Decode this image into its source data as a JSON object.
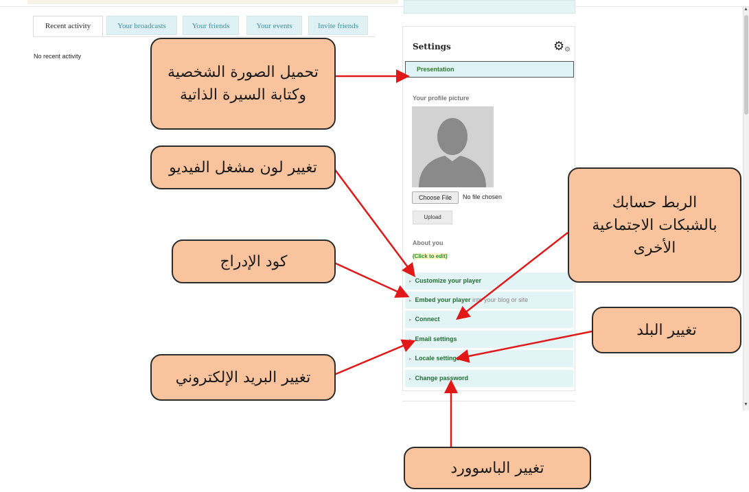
{
  "tabs": [
    "Recent activity",
    "Your broadcasts",
    "Your friends",
    "Your events",
    "Invite friends"
  ],
  "activity": {
    "empty_text": "No recent activity"
  },
  "settings": {
    "title": "Settings",
    "presentation": "Presentation",
    "profile_picture_label": "Your profile picture",
    "choose_file": "Choose File",
    "no_file": "No file chosen",
    "upload": "Upload",
    "about_label": "About you",
    "click_to_edit": "(Click to edit)",
    "menu": [
      {
        "label": "Customize your player",
        "sub": ""
      },
      {
        "label": "Embed your player",
        "sub": " into your blog or site"
      },
      {
        "label": "Connect",
        "sub": ""
      },
      {
        "label": "Email settings",
        "sub": ""
      },
      {
        "label": "Locale settings",
        "sub": ""
      },
      {
        "label": "Change password",
        "sub": ""
      }
    ]
  },
  "callouts": {
    "upload_photo": [
      "تحميل الصورة الشخصية",
      "وكتابة السيرة الذاتية"
    ],
    "player_color": "تغيير لون مشغل الفيديو",
    "embed_code": "كود الإدراج",
    "connect_social": [
      "الربط حسابك",
      "بالشبكات الاجتماعية",
      "الأخرى"
    ],
    "change_country": "تغيير البلد",
    "change_email": "تغيير البريد الإلكتروني",
    "change_password": "تغيير الباسوورد"
  },
  "colors": {
    "callout_fill": "#f9c49d",
    "arrow": "#e01818",
    "tab_bg": "#dff1f4",
    "menu_bg": "#e3f4f7",
    "link_green": "#1e6e2e"
  },
  "icons": [
    "gear-icon",
    "avatar-silhouette"
  ]
}
